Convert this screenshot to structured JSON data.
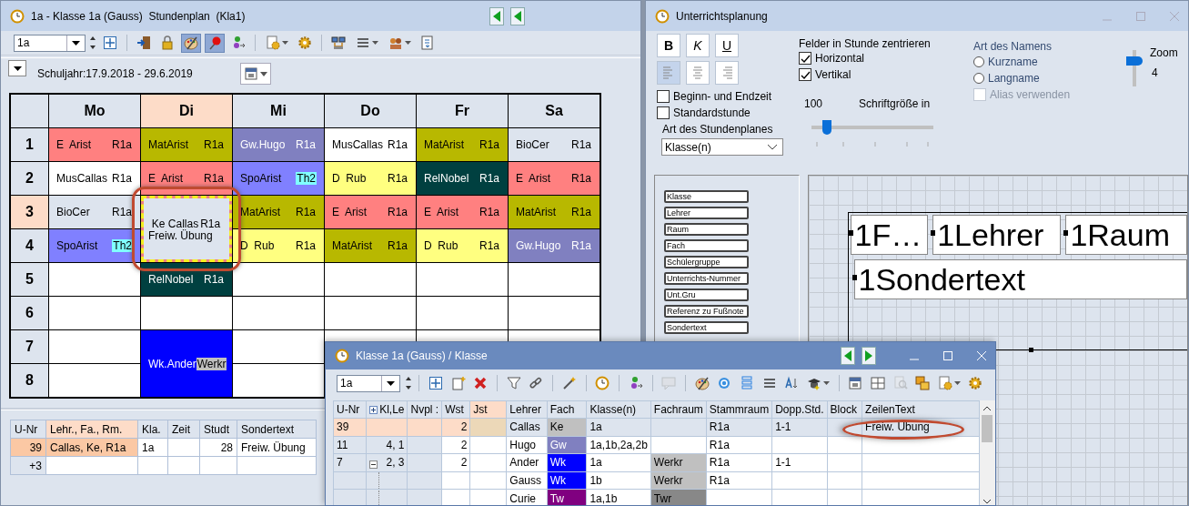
{
  "left_window": {
    "title": "1a - Klasse 1a (Gauss)  Stundenplan  (Kla1)",
    "class_select": {
      "value": "1a"
    },
    "toolbar": [
      [
        {
          "kind": "grid",
          "selected": false,
          "dropdown": false
        }
      ],
      [
        {
          "kind": "exit",
          "selected": false,
          "dropdown": false
        },
        {
          "kind": "lock",
          "selected": false,
          "dropdown": false
        },
        {
          "kind": "palette",
          "selected": true,
          "dropdown": false
        },
        {
          "kind": "pin",
          "selected": true,
          "dropdown": false
        },
        {
          "kind": "people-link",
          "selected": false,
          "dropdown": false
        }
      ],
      [
        {
          "kind": "doc-gear",
          "selected": false,
          "dropdown": true
        },
        {
          "kind": "gear",
          "selected": false,
          "dropdown": false
        }
      ],
      [
        {
          "kind": "network",
          "selected": false,
          "dropdown": false
        },
        {
          "kind": "list",
          "selected": false,
          "dropdown": true
        },
        {
          "kind": "people",
          "selected": false,
          "dropdown": true
        },
        {
          "kind": "export",
          "selected": false,
          "dropdown": false
        }
      ]
    ],
    "school_year": "Schuljahr:17.9.2018 - 29.6.2019",
    "timetable": {
      "periods": [
        {
          "label": "1",
          "selected": false
        },
        {
          "label": "2",
          "selected": false
        },
        {
          "label": "3",
          "selected": true
        },
        {
          "label": "4",
          "selected": false
        },
        {
          "label": "5",
          "selected": false
        },
        {
          "label": "6",
          "selected": false
        },
        {
          "label": "7",
          "selected": false
        },
        {
          "label": "8",
          "selected": false
        }
      ],
      "days": [
        {
          "label": "Mo",
          "selected": false,
          "cells": [
            {
              "kind": "lesson",
              "subject": "E  Arist",
              "room": "R1a",
              "color": "#ff8080",
              "double": false,
              "selected": false
            },
            {
              "kind": "lesson",
              "subject": "MusCallas",
              "room": "R1a",
              "color": "#ffffff",
              "double": false,
              "selected": false
            },
            {
              "kind": "lesson",
              "subject": "BioCer",
              "room": "R1a",
              "color": "#dde4ee",
              "double": false,
              "selected": false
            },
            {
              "kind": "lesson",
              "subject": "SpoArist",
              "room": {
                "text": "Th2",
                "color": "#80ffff"
              },
              "color": "#8080ff",
              "double": false,
              "selected": false
            },
            {
              "kind": "empty",
              "double": false,
              "selected": false
            },
            {
              "kind": "empty",
              "double": false,
              "selected": false
            },
            {
              "kind": "empty",
              "double": false,
              "selected": false
            },
            {
              "kind": "empty",
              "double": false,
              "selected": false
            }
          ]
        },
        {
          "label": "Di",
          "selected": true,
          "cells": [
            {
              "kind": "lesson",
              "subject": "MatArist",
              "room": "R1a",
              "color": "#b8b800",
              "double": false,
              "selected": false
            },
            {
              "kind": "lesson",
              "subject": "E  Arist",
              "room": "R1a",
              "color": "#ff8080",
              "double": false,
              "selected": false
            },
            {
              "kind": "lesson",
              "subject": "Ke Callas",
              "room": "R1a",
              "note": "Freiw. Übung",
              "color": "#dde4ee",
              "double": true,
              "selected": true
            },
            {
              "kind": "lesson",
              "subject": "RelNobel",
              "room": "R1a",
              "color": "#004040",
              "double": false,
              "selected": false
            },
            {
              "kind": "empty",
              "double": false,
              "selected": false
            },
            {
              "kind": "lesson",
              "subject": "Wk.Ander",
              "room": {
                "text": "Werkr",
                "color": "#c0c0c0"
              },
              "color": "#0000ff",
              "double": true,
              "selected": false
            }
          ]
        },
        {
          "label": "Mi",
          "selected": false,
          "cells": [
            {
              "kind": "lesson",
              "subject": "Gw.Hugo",
              "room": "R1a",
              "color": "#8080c0",
              "double": false,
              "selected": false
            },
            {
              "kind": "lesson",
              "subject": "SpoArist",
              "room": {
                "text": "Th2",
                "color": "#80ffff"
              },
              "color": "#8080ff",
              "double": false,
              "selected": false
            },
            {
              "kind": "lesson",
              "subject": "MatArist",
              "room": "R1a",
              "color": "#b8b800",
              "double": false,
              "selected": false
            },
            {
              "kind": "lesson",
              "subject": "D  Rub",
              "room": "R1a",
              "color": "#ffff80",
              "double": false,
              "selected": false
            },
            {
              "kind": "empty",
              "double": false,
              "selected": false
            },
            {
              "kind": "empty",
              "double": false,
              "selected": false
            },
            {
              "kind": "empty",
              "double": false,
              "selected": false
            },
            {
              "kind": "empty",
              "double": false,
              "selected": false
            }
          ]
        },
        {
          "label": "Do",
          "selected": false,
          "cells": [
            {
              "kind": "lesson",
              "subject": "MusCallas",
              "room": "R1a",
              "color": "#ffffff",
              "double": false,
              "selected": false
            },
            {
              "kind": "lesson",
              "subject": "D  Rub",
              "room": "R1a",
              "color": "#ffff80",
              "double": false,
              "selected": false
            },
            {
              "kind": "lesson",
              "subject": "E  Arist",
              "room": "R1a",
              "color": "#ff8080",
              "double": false,
              "selected": false
            },
            {
              "kind": "lesson",
              "subject": "MatArist",
              "room": "R1a",
              "color": "#b8b800",
              "double": false,
              "selected": false
            },
            {
              "kind": "empty",
              "double": false,
              "selected": false
            },
            {
              "kind": "empty",
              "double": false,
              "selected": false
            },
            {
              "kind": "empty",
              "double": false,
              "selected": false
            }
          ]
        },
        {
          "label": "Fr",
          "selected": false,
          "cells": [
            {
              "kind": "lesson",
              "subject": "MatArist",
              "room": "R1a",
              "color": "#b8b800",
              "double": false,
              "selected": false
            },
            {
              "kind": "lesson",
              "subject": "RelNobel",
              "room": "R1a",
              "color": "#004040",
              "double": false,
              "selected": false
            },
            {
              "kind": "lesson",
              "subject": "E  Arist",
              "room": "R1a",
              "color": "#ff8080",
              "double": false,
              "selected": false
            },
            {
              "kind": "lesson",
              "subject": "D  Rub",
              "room": "R1a",
              "color": "#ffff80",
              "double": false,
              "selected": false
            },
            {
              "kind": "empty",
              "double": false,
              "selected": false
            },
            {
              "kind": "empty",
              "double": false,
              "selected": false
            },
            {
              "kind": "empty",
              "double": false,
              "selected": false
            }
          ]
        },
        {
          "label": "Sa",
          "selected": false,
          "cells": [
            {
              "kind": "lesson",
              "subject": "BioCer",
              "room": "R1a",
              "color": "#dde4ee",
              "double": false,
              "selected": false
            },
            {
              "kind": "lesson",
              "subject": "E  Arist",
              "room": "R1a",
              "color": "#ff8080",
              "double": false,
              "selected": false
            },
            {
              "kind": "lesson",
              "subject": "MatArist",
              "room": "R1a",
              "color": "#b8b800",
              "double": false,
              "selected": false
            },
            {
              "kind": "lesson",
              "subject": "Gw.Hugo",
              "room": "R1a",
              "color": "#8080c0",
              "double": false,
              "selected": false
            },
            {
              "kind": "empty",
              "double": false,
              "selected": false
            },
            {
              "kind": "empty",
              "double": false,
              "selected": false
            },
            {
              "kind": "empty",
              "double": false,
              "selected": false
            }
          ]
        }
      ]
    },
    "lesson_table": {
      "columns": [
        {
          "label": "U-Nr",
          "selected": false
        },
        {
          "label": "Lehr., Fa., Rm.",
          "selected": true
        },
        {
          "label": "Kla.",
          "selected": false
        },
        {
          "label": "Zeit",
          "selected": false
        },
        {
          "label": "Studt",
          "selected": false
        },
        {
          "label": "Sondertext",
          "selected": false
        }
      ],
      "rows": [
        {
          "selected": true,
          "cells": [
            "39",
            "Callas, Ke, R1a",
            "1a",
            null,
            "28",
            "Freiw. Übung"
          ]
        },
        {
          "selected": false,
          "cells": [
            "+3",
            null,
            null,
            null,
            null,
            null
          ]
        }
      ]
    }
  },
  "right_window": {
    "title": "Unterrichtsplanung",
    "format_buttons": [
      {
        "label": "B",
        "kind": "bold",
        "selected": false
      },
      {
        "label": "K",
        "kind": "italic",
        "selected": false
      },
      {
        "label": "U",
        "kind": "underline",
        "selected": false
      }
    ],
    "align_buttons": [
      {
        "kind": "left",
        "selected": true
      },
      {
        "kind": "center",
        "selected": false
      },
      {
        "kind": "right",
        "selected": false
      }
    ],
    "options": [
      {
        "label": "Beginn- und Endzeit",
        "checked": false
      },
      {
        "label": "Standardstunde",
        "checked": false
      }
    ],
    "plan_type": {
      "label": "Art des Stundenplanes",
      "value": "Klasse(n)"
    },
    "centering": {
      "label": "Felder in Stunde zentrieren",
      "options": [
        {
          "label": "Horizontal",
          "checked": true
        },
        {
          "label": "Vertikal",
          "checked": true
        }
      ]
    },
    "font_size": {
      "reading": "100",
      "label": "Schriftgröße in",
      "level": 0.13
    },
    "name_type": {
      "label": "Art des Namens",
      "options": [
        {
          "label": "Kurzname",
          "selected": false
        },
        {
          "label": "Langname",
          "selected": false
        }
      ],
      "alias": {
        "label": "Alias verwenden",
        "checked": false,
        "disabled": true
      }
    },
    "zoom": {
      "label": "Zoom",
      "reading": "4",
      "level": 0.7
    },
    "fields": [
      "Klasse",
      "Lehrer",
      "Raum",
      "Fach",
      "Schülergruppe",
      "Unterrichts-Nummer",
      "Unt.Gru",
      "Referenz zu Fußnote",
      "Sondertext"
    ],
    "layout_rows": [
      [
        "1F…",
        "1Lehrer",
        "1Raum"
      ],
      [
        "1Sondertext"
      ]
    ]
  },
  "bottom_window": {
    "title": "Klasse 1a (Gauss) / Klasse",
    "class_select": {
      "value": "1a"
    },
    "toolbar": [
      [
        {
          "kind": "grid",
          "disabled": false,
          "dropdown": false
        },
        {
          "kind": "new",
          "disabled": false,
          "dropdown": false
        },
        {
          "kind": "delete",
          "disabled": false,
          "dropdown": false
        }
      ],
      [
        {
          "kind": "filter",
          "disabled": false,
          "dropdown": false
        },
        {
          "kind": "link",
          "disabled": false,
          "dropdown": false
        }
      ],
      [
        {
          "kind": "wand",
          "disabled": false,
          "dropdown": false
        }
      ],
      [
        {
          "kind": "clock",
          "disabled": false,
          "dropdown": false
        }
      ],
      [
        {
          "kind": "people-link",
          "disabled": false,
          "dropdown": false
        }
      ],
      [
        {
          "kind": "comment",
          "disabled": true,
          "dropdown": false
        }
      ],
      [
        {
          "kind": "palette",
          "disabled": false,
          "dropdown": false
        },
        {
          "kind": "refresh",
          "disabled": false,
          "dropdown": false
        },
        {
          "kind": "rows",
          "disabled": false,
          "dropdown": false
        },
        {
          "kind": "list",
          "disabled": false,
          "dropdown": false
        },
        {
          "kind": "sort",
          "disabled": false,
          "dropdown": false
        },
        {
          "kind": "cap",
          "disabled": false,
          "dropdown": true
        }
      ],
      [
        {
          "kind": "calendar",
          "disabled": false,
          "dropdown": false
        },
        {
          "kind": "table",
          "disabled": false,
          "dropdown": false
        },
        {
          "kind": "zoomdoc",
          "disabled": true,
          "dropdown": false
        },
        {
          "kind": "windows",
          "disabled": false,
          "dropdown": false
        },
        {
          "kind": "doc-gear",
          "disabled": false,
          "dropdown": true
        },
        {
          "kind": "gear",
          "disabled": false,
          "dropdown": false
        }
      ]
    ],
    "columns": [
      {
        "label": "U-Nr",
        "kind": "plain",
        "selected": false
      },
      {
        "label": "Kl,Le",
        "kind": "expander",
        "selected": false
      },
      {
        "label": "Nvpl :",
        "kind": "plain",
        "selected": false
      },
      {
        "label": "Wst",
        "kind": "plain",
        "selected": false
      },
      {
        "label": "Jst",
        "kind": "plain",
        "selected": true
      },
      {
        "label": "Lehrer",
        "kind": "plain",
        "selected": false
      },
      {
        "label": "Fach",
        "kind": "plain",
        "selected": false
      },
      {
        "label": "Klasse(n)",
        "kind": "plain",
        "selected": false
      },
      {
        "label": "Fachraum",
        "kind": "plain",
        "selected": false
      },
      {
        "label": "Stammraum",
        "kind": "plain",
        "selected": false
      },
      {
        "label": "Dopp.Std.",
        "kind": "plain",
        "selected": false
      },
      {
        "label": "Block",
        "kind": "plain",
        "selected": false
      },
      {
        "label": "ZeilenText",
        "kind": "plain",
        "selected": false
      }
    ],
    "rows": [
      {
        "kind": "single",
        "selected": true,
        "cells": [
          "39",
          null,
          null,
          "2",
          null,
          "Callas",
          {
            "text": "Ke",
            "color": "#c0c0c0"
          },
          "1a",
          null,
          "R1a",
          "1-1",
          null,
          "Freiw. Übung"
        ]
      },
      {
        "kind": "single",
        "selected": false,
        "cells": [
          "11",
          "4, 1",
          null,
          "2",
          null,
          "Hugo",
          {
            "text": "Gw",
            "color": "#8080c0"
          },
          "1a,1b,2a,2b",
          null,
          "R1a",
          null,
          null,
          null
        ]
      },
      {
        "kind": "group",
        "selected": false,
        "expanded": true,
        "cells": [
          "7",
          "2, 3",
          null,
          "2",
          null,
          "Ander",
          {
            "text": "Wk",
            "color": "#0000ff"
          },
          "1a",
          {
            "text": "Werkr",
            "color": "#c0c0c0"
          },
          "R1a",
          "1-1",
          null,
          null
        ],
        "children": [
          {
            "selected": false,
            "cells": [
              null,
              null,
              null,
              null,
              null,
              "Gauss",
              {
                "text": "Wk",
                "color": "#0000ff"
              },
              "1b",
              {
                "text": "Werkr",
                "color": "#c0c0c0"
              },
              "R1a",
              null,
              null,
              null
            ]
          },
          {
            "selected": false,
            "cells": [
              null,
              null,
              null,
              null,
              null,
              "Curie",
              {
                "text": "Tw",
                "color": "#800080"
              },
              "1a,1b",
              {
                "text": "Twr",
                "color": "#888888"
              },
              null,
              null,
              null,
              null
            ]
          }
        ]
      }
    ]
  }
}
